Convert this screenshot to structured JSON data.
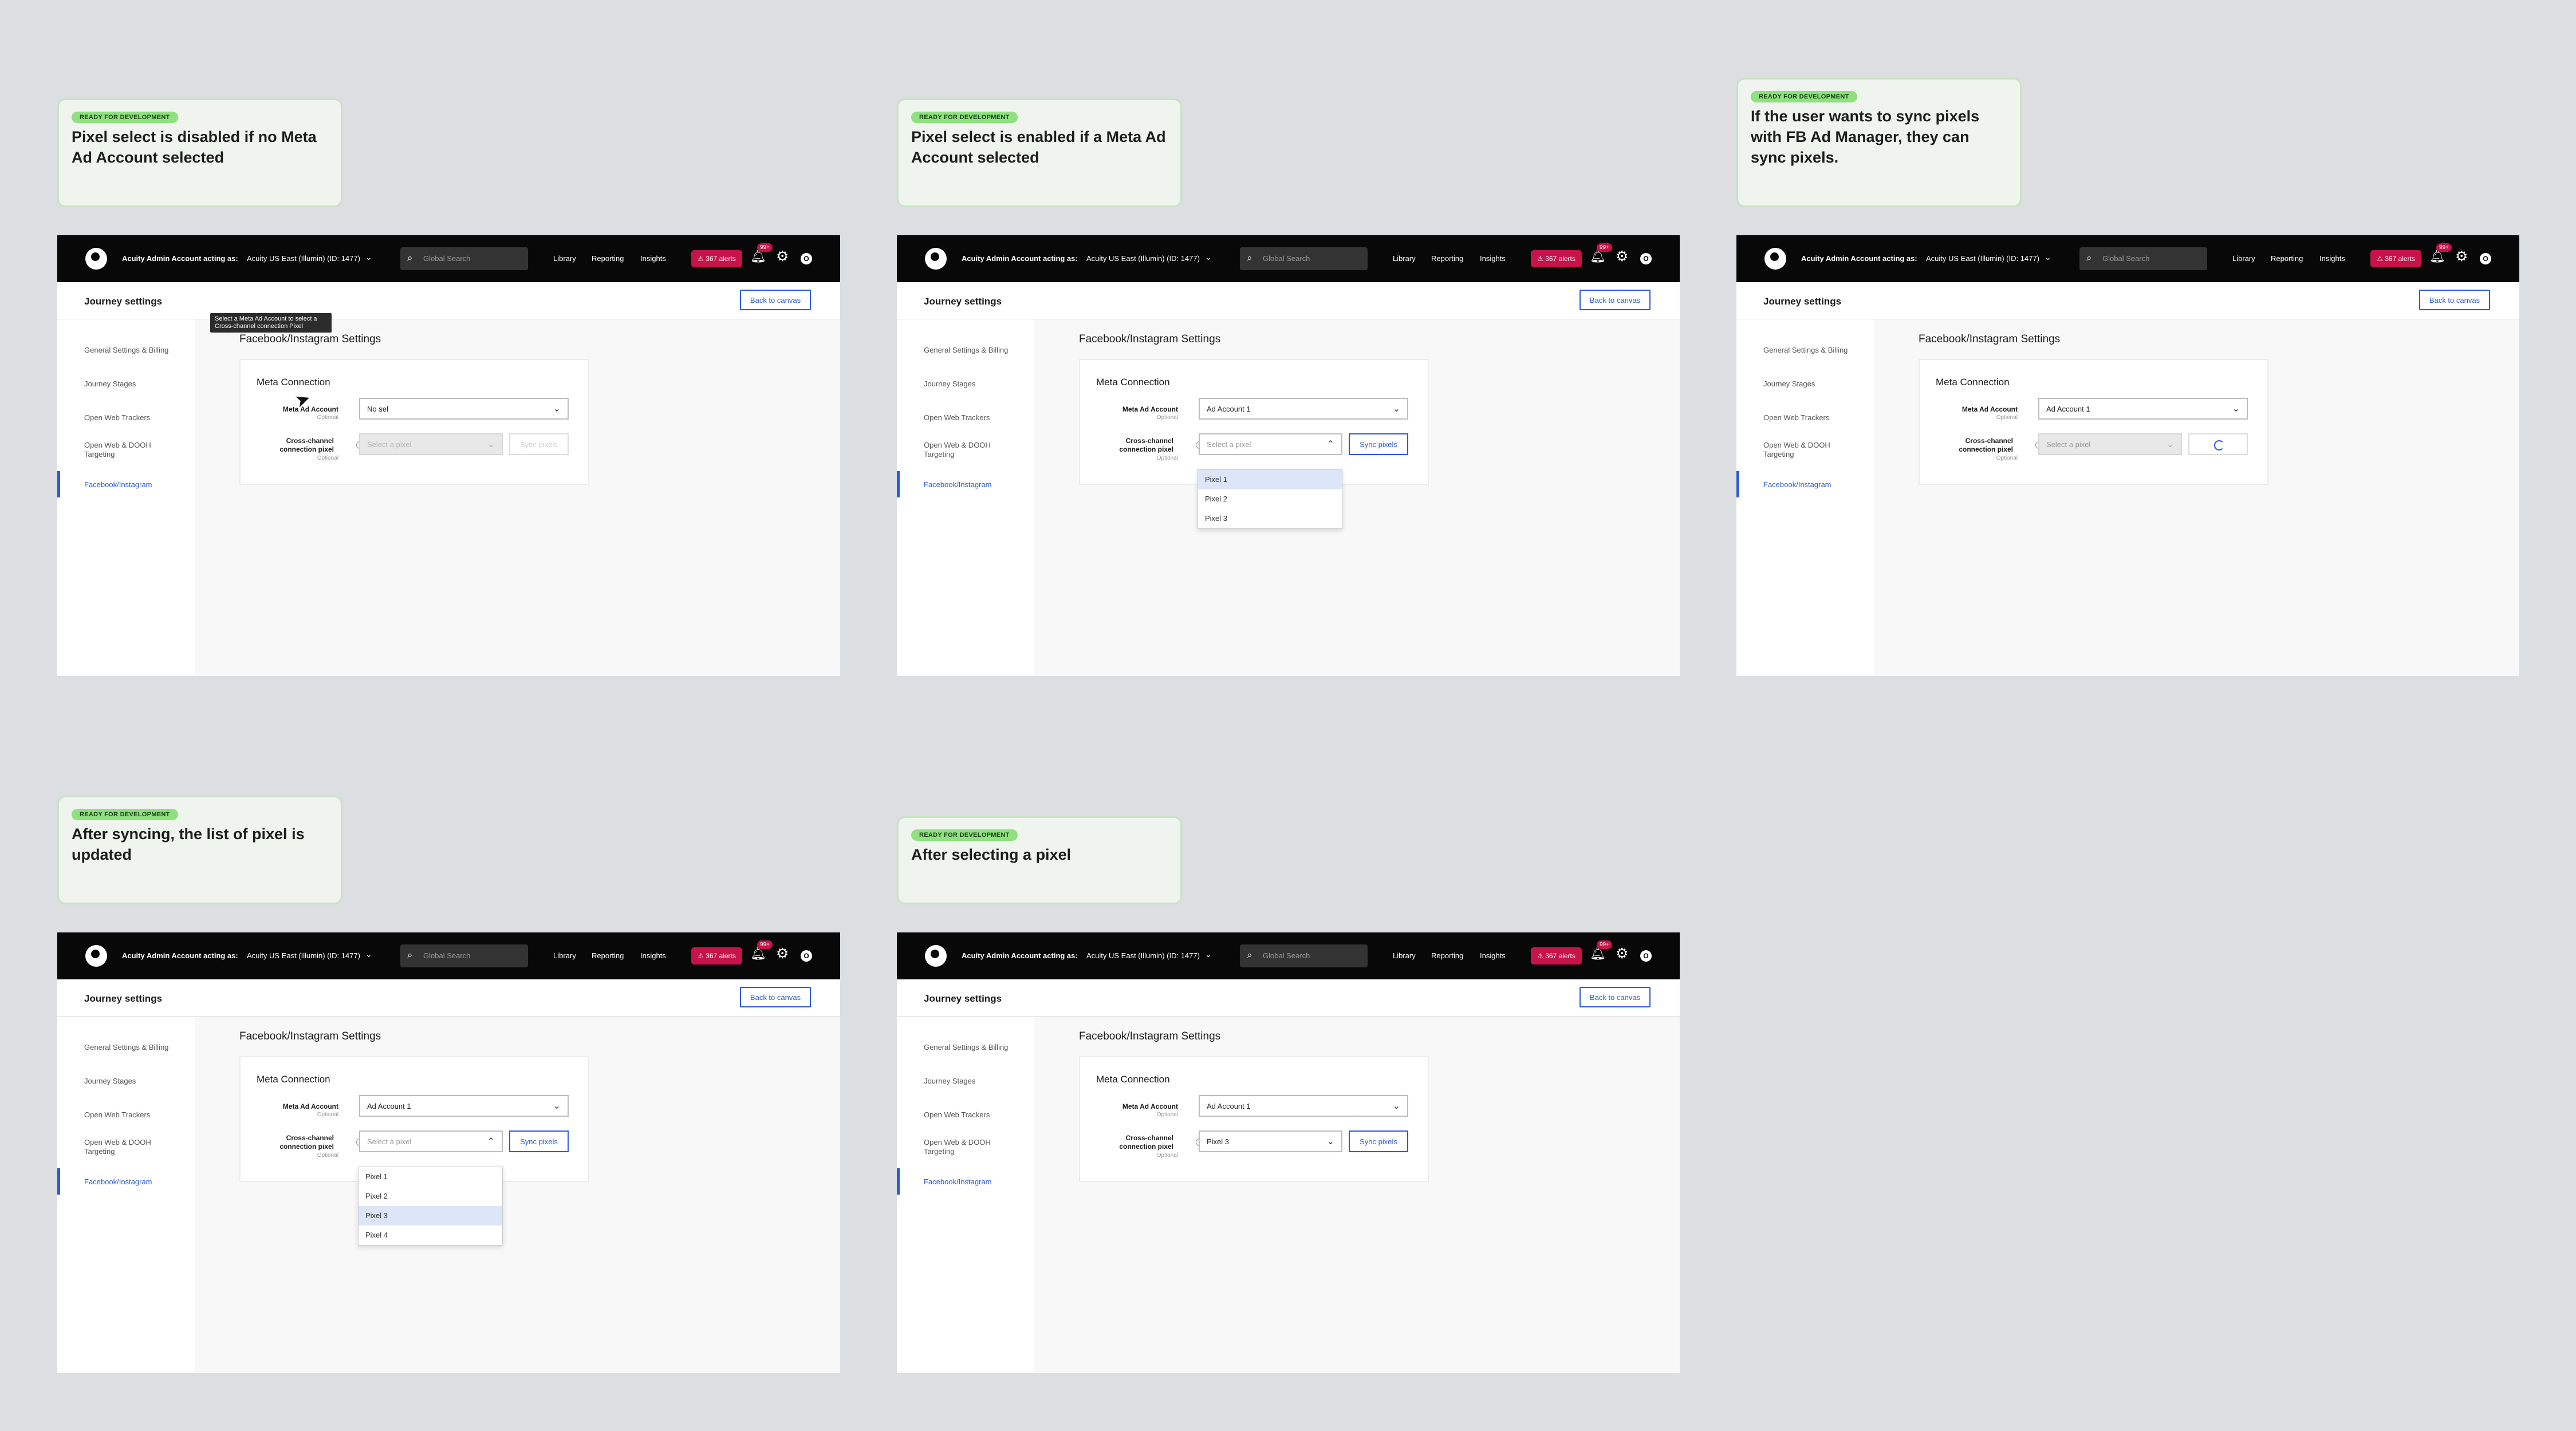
{
  "notes": [
    {
      "badge": "READY FOR DEVELOPMENT",
      "title": "Pixel select is disabled if no Meta Ad Account selected"
    },
    {
      "badge": "READY FOR DEVELOPMENT",
      "title": "Pixel select is enabled if a Meta Ad Account selected"
    },
    {
      "badge": "READY FOR DEVELOPMENT",
      "title": "If the user wants to sync pixels with FB Ad Manager, they can sync pixels."
    },
    {
      "badge": "READY FOR DEVELOPMENT",
      "title": "After syncing, the list of pixel is updated"
    },
    {
      "badge": "READY FOR DEVELOPMENT",
      "title": "After selecting a pixel"
    }
  ],
  "app": {
    "account_label": "Acuity Admin Account acting as:",
    "account_value": "Acuity US East (Illumin) (ID: 1477)",
    "search_placeholder": "Global Search",
    "nav": [
      "Library",
      "Reporting",
      "Insights"
    ],
    "alerts": "367 alerts",
    "notif_badge": "99+",
    "avatar": "O",
    "page_title": "Journey settings",
    "back_button": "Back to canvas",
    "sidebar": [
      "General Settings & Billing",
      "Journey Stages",
      "Open Web Trackers",
      "Open Web & DOOH Targeting",
      "Facebook/Instagram"
    ],
    "section_title": "Facebook/Instagram Settings",
    "card_title": "Meta Connection",
    "ad_account_label": "Meta Ad Account",
    "pixel_label": "Cross-channel connection pixel",
    "optional": "Optional",
    "sync_button": "Sync pixels",
    "select_pixel_placeholder": "Select a pixel",
    "help_icon": "?"
  },
  "screens": [
    {
      "ad_account": "No sel",
      "pixel": "Select a pixel",
      "tooltip": "Select a Meta Ad Account to select a Cross-channel connection Pixel"
    },
    {
      "ad_account": "Ad Account 1",
      "pixel": "Select a pixel",
      "options": [
        "Pixel 1",
        "Pixel 2",
        "Pixel 3"
      ],
      "highlighted": "Pixel 1"
    },
    {
      "ad_account": "Ad Account 1",
      "pixel": "Select a pixel"
    },
    {
      "ad_account": "Ad Account 1",
      "pixel": "Select a pixel",
      "options": [
        "Pixel 1",
        "Pixel 2",
        "Pixel 3",
        "Pixel 4"
      ],
      "highlighted": "Pixel 3"
    },
    {
      "ad_account": "Ad Account 1",
      "pixel": "Pixel 3"
    }
  ],
  "colors": {
    "accent": "#2a5bd7",
    "alert": "#c8124a",
    "badge": "#8fe07f",
    "topbar": "#080808"
  }
}
